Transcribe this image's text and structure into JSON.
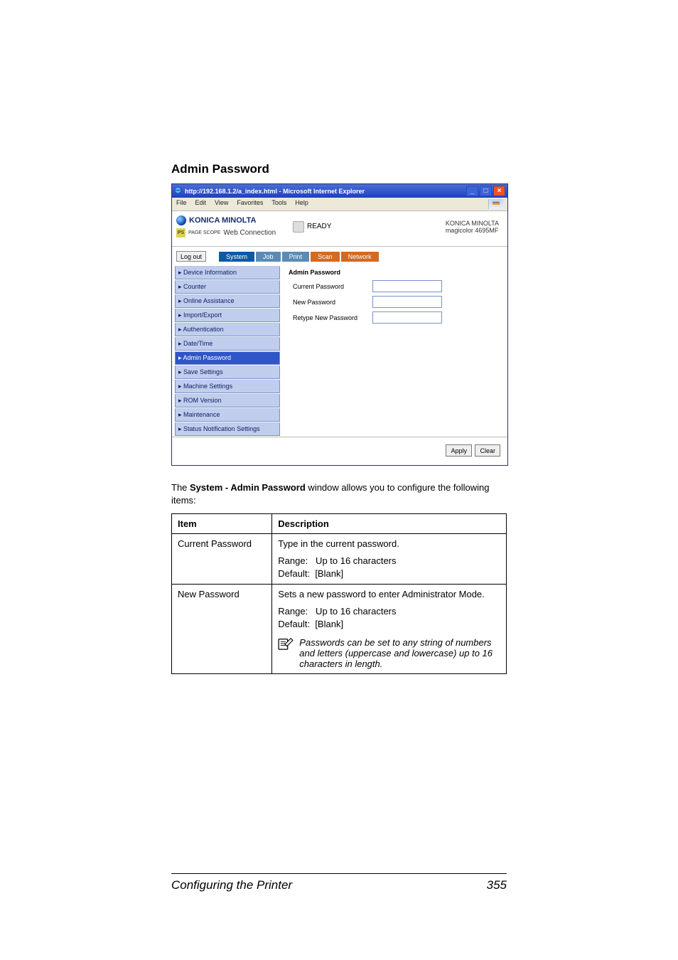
{
  "heading": "Admin Password",
  "caption_prefix": "The ",
  "caption_bold": "System - Admin Password",
  "caption_suffix": " window allows you to configure the following items:",
  "footer_title": "Configuring the Printer",
  "footer_page": "355",
  "browser": {
    "title": "http://192.168.1.2/a_index.html - Microsoft Internet Explorer",
    "menus": [
      "File",
      "Edit",
      "View",
      "Favorites",
      "Tools",
      "Help"
    ],
    "brand": "KONICA MINOLTA",
    "sub_brand_prefix": "PAGE SCOPE",
    "sub_brand": "Web Connection",
    "status": "READY",
    "model_line1": "KONICA MINOLTA",
    "model_line2": "magicolor 4695MF",
    "logout": "Log out",
    "tabs": {
      "system": "System",
      "job": "Job",
      "print": "Print",
      "scan": "Scan",
      "network": "Network"
    },
    "sidebar": [
      "Device Information",
      "Counter",
      "Online Assistance",
      "Import/Export",
      "Authentication",
      "Date/Time",
      "Admin Password",
      "Save Settings",
      "Machine Settings",
      "ROM Version",
      "Maintenance",
      "Status Notification Settings"
    ],
    "active_index": 6,
    "form": {
      "title": "Admin Password",
      "rows": [
        {
          "label": "Current Password"
        },
        {
          "label": "New Password"
        },
        {
          "label": "Retype New Password"
        }
      ]
    },
    "apply": "Apply",
    "clear": "Clear"
  },
  "table": {
    "head_item": "Item",
    "head_desc": "Description",
    "rows": [
      {
        "item": "Current Password",
        "desc_main": "Type in the current password.",
        "range": "Range:   Up to 16 characters",
        "default": "Default:  [Blank]",
        "note": ""
      },
      {
        "item": "New Password",
        "desc_main": "Sets a new password to enter Administrator Mode.",
        "range": "Range:   Up to 16 characters",
        "default": "Default:  [Blank]",
        "note": "Passwords can be set to any string of numbers and letters (uppercase and lowercase) up to 16 characters in length."
      }
    ]
  }
}
